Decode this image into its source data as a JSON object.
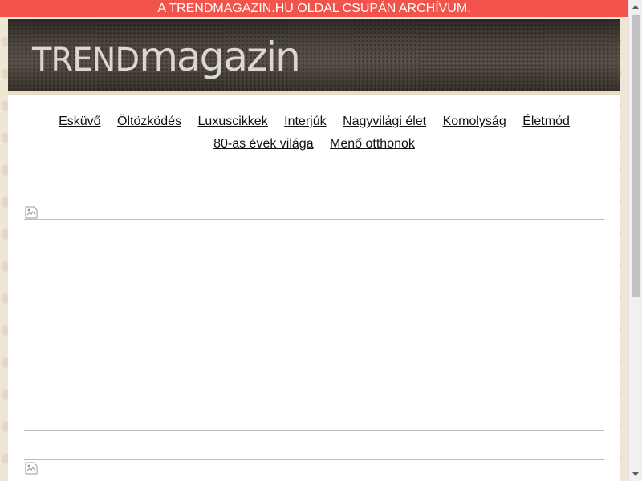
{
  "banner": {
    "text": "A TRENDMAGAZIN.HU OLDAL CSUPÁN ARCHÍVUM."
  },
  "header": {
    "logo_trend": "TREND",
    "logo_magazin": "magazin"
  },
  "nav": {
    "row1": [
      {
        "label": "Esküvő"
      },
      {
        "label": "Öltözködés"
      },
      {
        "label": "Luxuscikkek"
      },
      {
        "label": "Interjúk"
      },
      {
        "label": "Nagyvilági élet"
      },
      {
        "label": "Komolyság"
      },
      {
        "label": "Életmód"
      }
    ],
    "row2": [
      {
        "label": "80-as évek világa"
      },
      {
        "label": "Menő otthonok"
      }
    ]
  },
  "colors": {
    "banner_bg": "#f2534b",
    "header_bg": "#4e4740",
    "page_bg": "#efe6d6"
  },
  "icons": {
    "broken_image": "broken-image-icon",
    "scroll_up": "scroll-up-arrow-icon",
    "scroll_down": "scroll-down-arrow-icon"
  }
}
